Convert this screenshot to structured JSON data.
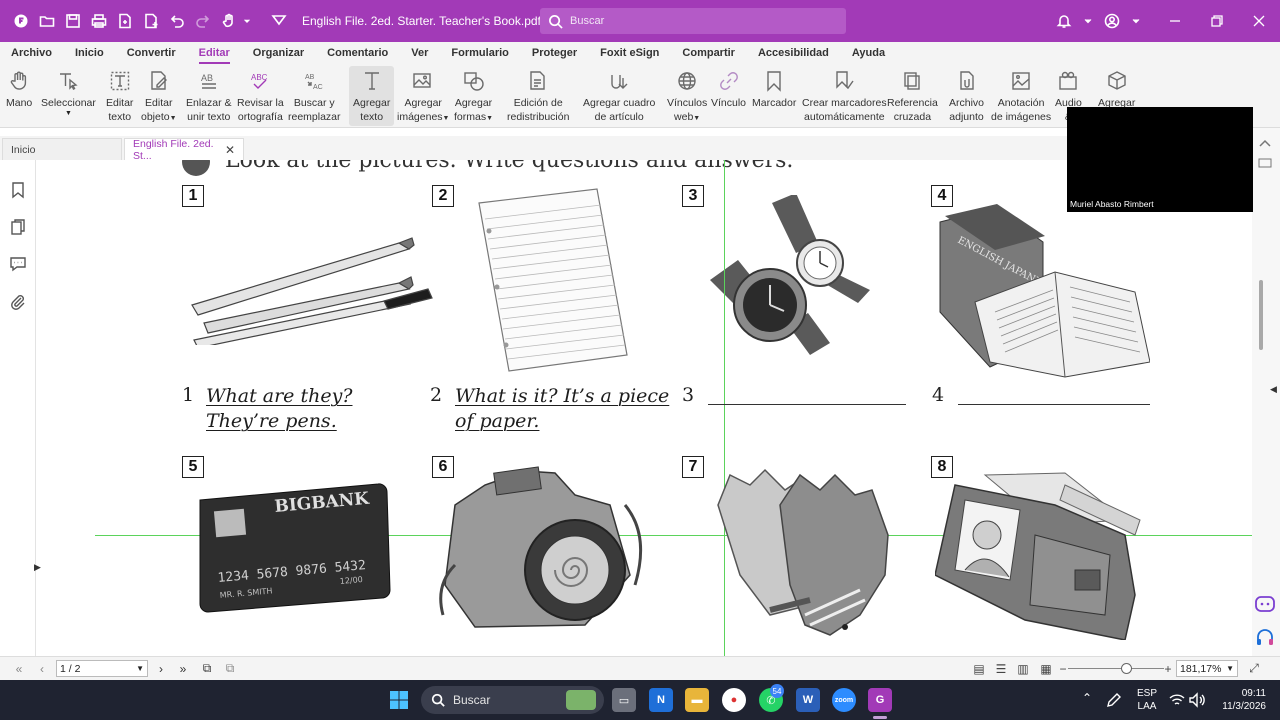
{
  "titlebar": {
    "doc_title": "English File. 2ed. Starter. Teacher's Book.pdf * - Fo...",
    "search_placeholder": "Buscar"
  },
  "menu": [
    "Archivo",
    "Inicio",
    "Convertir",
    "Editar",
    "Organizar",
    "Comentario",
    "Ver",
    "Formulario",
    "Proteger",
    "Foxit eSign",
    "Compartir",
    "Accesibilidad",
    "Ayuda"
  ],
  "menu_active": "Editar",
  "ribbon": {
    "mano": "Mano",
    "seleccionar": "Seleccionar",
    "editar_texto_1": "Editar",
    "editar_texto_2": "texto",
    "editar_objeto_1": "Editar",
    "editar_objeto_2": "objeto",
    "enlazar_1": "Enlazar &",
    "enlazar_2": "unir texto",
    "revisar_1": "Revisar la",
    "revisar_2": "ortografía",
    "buscar_1": "Buscar y",
    "buscar_2": "reemplazar",
    "agregar_texto_1": "Agregar",
    "agregar_texto_2": "texto",
    "agregar_imagenes_1": "Agregar",
    "agregar_imagenes_2": "imágenes",
    "agregar_formas_1": "Agregar",
    "agregar_formas_2": "formas",
    "edicion_1": "Edición de",
    "edicion_2": "redistribución",
    "cuadro_1": "Agregar cuadro",
    "cuadro_2": "de artículo",
    "vinculos_1": "Vínculos",
    "vinculos_2": "web",
    "vinculo": "Vínculo",
    "marcador": "Marcador",
    "crear_marcadores_1": "Crear marcadores",
    "crear_marcadores_2": "automáticamente",
    "referencia_1": "Referencia",
    "referencia_2": "cruzada",
    "archivo_adjunto_1": "Archivo",
    "archivo_adjunto_2": "adjunto",
    "anotacion_1": "Anotación",
    "anotacion_2": "de imágenes",
    "audio_1": "Audio",
    "audio_2": "&",
    "agregar_last": "Agregar"
  },
  "tabs": {
    "home": "Inicio",
    "doc": "English File. 2ed. St..."
  },
  "document": {
    "heading": "Look at the pictures. Write questions and answers.",
    "items": [
      "1",
      "2",
      "3",
      "4",
      "5",
      "6",
      "7",
      "8"
    ],
    "answers": {
      "a1_num": "1",
      "a1_line1": "What are they?",
      "a1_line2": "They’re pens.",
      "a2_num": "2",
      "a2_line1": "What is it? It’s a piece",
      "a2_line2": "of paper.",
      "a3_num": "3",
      "a4_num": "4"
    },
    "card_bank": "BIGBANK",
    "card_number": "1234 5678 9876 5432",
    "card_name": "MR. R. SMITH",
    "card_exp": "12/00",
    "book_title": "ENGLISH JAPANESE"
  },
  "video": {
    "participant": "Muriel Abasto Rimbert"
  },
  "statusbar": {
    "page": "1 / 2",
    "zoom": "181,17%"
  },
  "taskbar": {
    "search": "Buscar",
    "whatsapp_badge": "54",
    "lang_1": "ESP",
    "lang_2": "LAA",
    "time": "09:11",
    "date": "11/3/2026"
  },
  "colors": {
    "brand": "#a23ab7",
    "guide": "#5bd35b",
    "taskbar": "#1f2331"
  }
}
